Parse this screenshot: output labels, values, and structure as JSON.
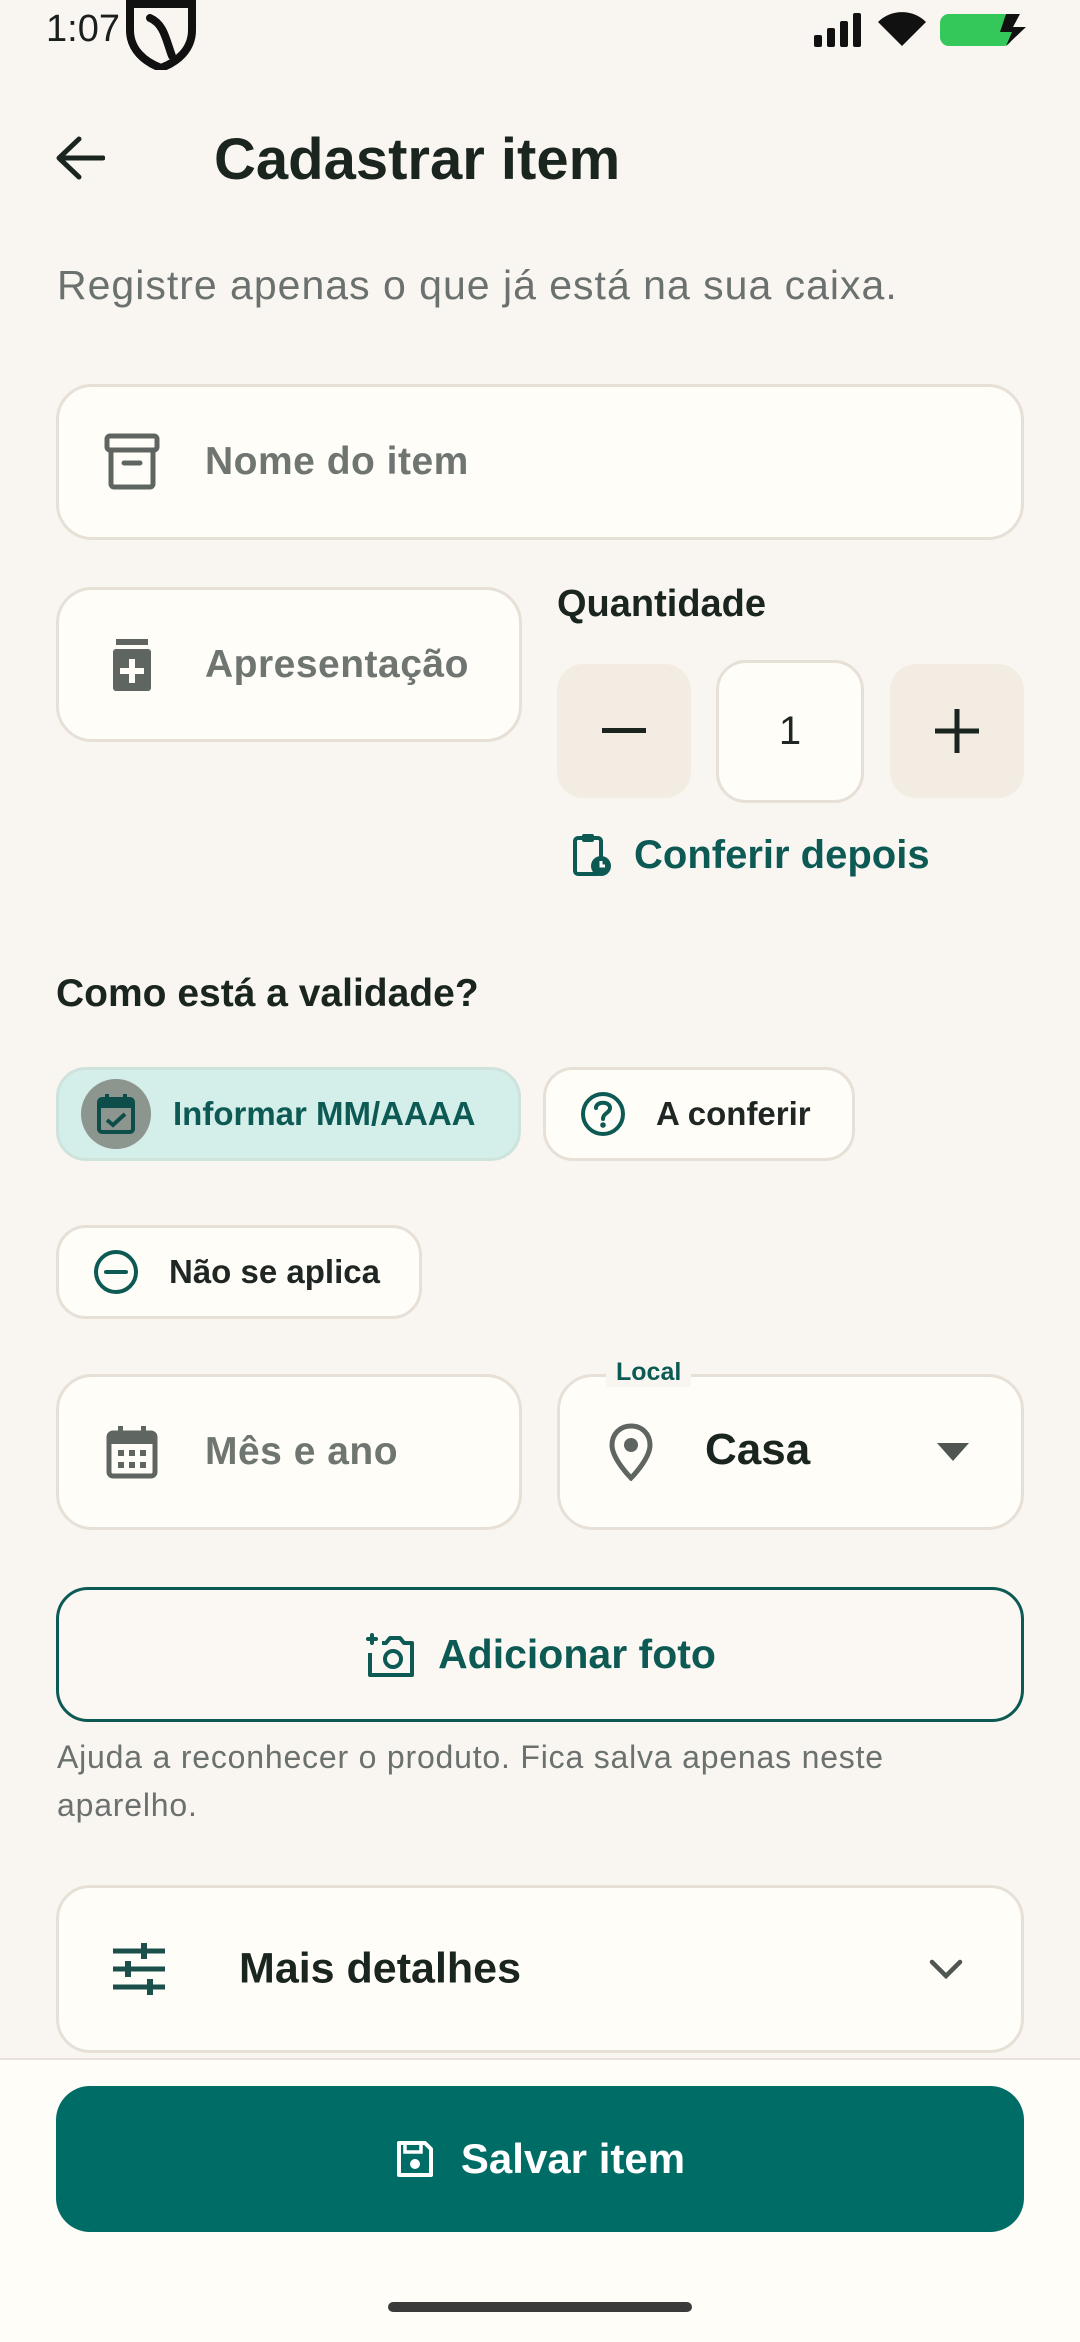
{
  "status": {
    "time": "1:07",
    "icons": [
      "signal-icon",
      "wifi-icon",
      "battery-charging-icon"
    ],
    "battery_color": "#34c759"
  },
  "header": {
    "title": "Cadastrar item"
  },
  "subtitle": "Registre apenas o que já está na sua caixa.",
  "form": {
    "name_placeholder": "Nome do item",
    "presentation_placeholder": "Apresentação",
    "quantity_label": "Quantidade",
    "quantity_value": "1",
    "check_later": "Conferir depois",
    "validity_title": "Como está a validade?",
    "validity_options": {
      "month_year": "Informar MM/AAAA",
      "to_check": "A conferir",
      "not_applicable": "Não se aplica"
    },
    "validity_selected": "month_year",
    "date_placeholder": "Mês e ano",
    "local_label": "Local",
    "local_value": "Casa",
    "add_photo": "Adicionar foto",
    "photo_help": "Ajuda a reconhecer o produto. Fica salva apenas neste aparelho.",
    "more_details": "Mais detalhes"
  },
  "footer": {
    "save_label": "Salvar item"
  },
  "colors": {
    "accent": "#0d5a55",
    "primary_button": "#006c66",
    "background": "#f9f6f1",
    "selected_chip": "#d4eeea"
  }
}
